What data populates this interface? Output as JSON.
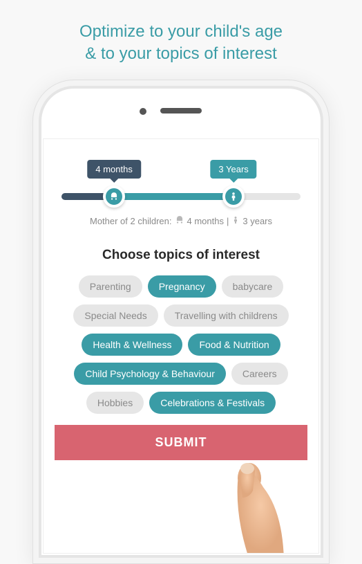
{
  "headline_line1": "Optimize to your child's age",
  "headline_line2": "& to your topics of interest",
  "slider": {
    "start_label": "4 months",
    "end_label": "3 Years"
  },
  "summary": {
    "prefix": "Mother of 2 children:",
    "child1": "4 months",
    "divider": "|",
    "child2": "3 years"
  },
  "topics_title": "Choose topics of interest",
  "topics": [
    {
      "label": "Parenting",
      "active": false
    },
    {
      "label": "Pregnancy",
      "active": true
    },
    {
      "label": "babycare",
      "active": false
    },
    {
      "label": "Special Needs",
      "active": false
    },
    {
      "label": "Travelling with childrens",
      "active": false
    },
    {
      "label": "Health & Wellness",
      "active": true
    },
    {
      "label": "Food & Nutrition",
      "active": true
    },
    {
      "label": "Child Psychology & Behaviour",
      "active": true
    },
    {
      "label": "Careers",
      "active": false
    },
    {
      "label": "Hobbies",
      "active": false
    },
    {
      "label": "Celebrations & Festivals",
      "active": true
    }
  ],
  "submit_label": "SUBMIT"
}
